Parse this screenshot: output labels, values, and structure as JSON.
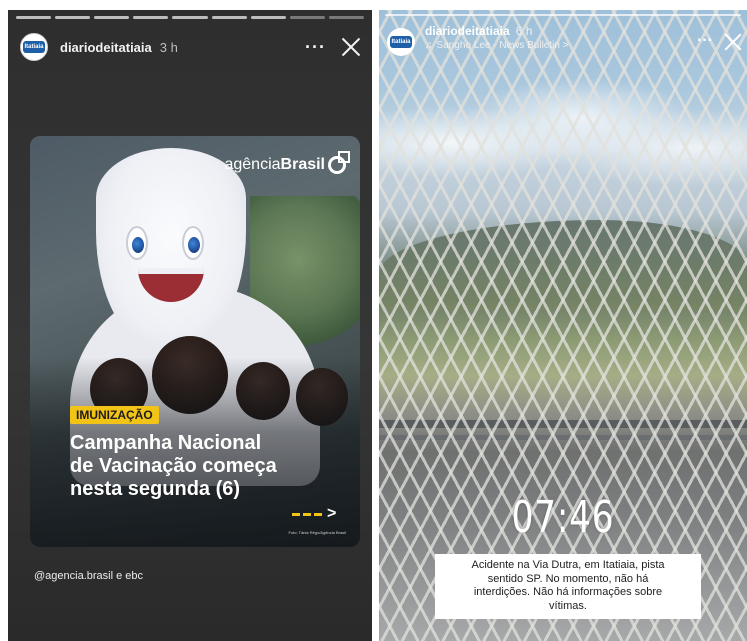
{
  "left_story": {
    "username": "diariodeitatiaia",
    "time": "3 h",
    "more_label": "···",
    "avatar_text": "Itatiaia",
    "card": {
      "logo_light": "agência",
      "logo_bold": "Brasil",
      "tag": "IMUNIZAÇÃO",
      "headline": [
        "Campanha Nacional",
        "de Vacinação começa",
        "nesta segunda (6)"
      ],
      "arrow": ">",
      "photo_credit": "Foto: Tânia Rêgo/Agência Brasil",
      "accent_color": "#f2c417"
    },
    "mention": "@agencia.brasil e ebc"
  },
  "right_story": {
    "username": "diariodeitatiaia",
    "time": "6 h",
    "music": "Sangho Lee · News Bulletin >",
    "more_label": "···",
    "avatar_text": "Itatiaia",
    "clock": "07:46",
    "caption": [
      "Acidente na Via Dutra, em Itatiaia, pista",
      "sentido SP. No momento, não há",
      "interdições. Não há informações sobre",
      "vítimas."
    ]
  },
  "icons": {
    "close": "close-icon",
    "more": "more-options-icon",
    "music": "music-note-icon"
  }
}
